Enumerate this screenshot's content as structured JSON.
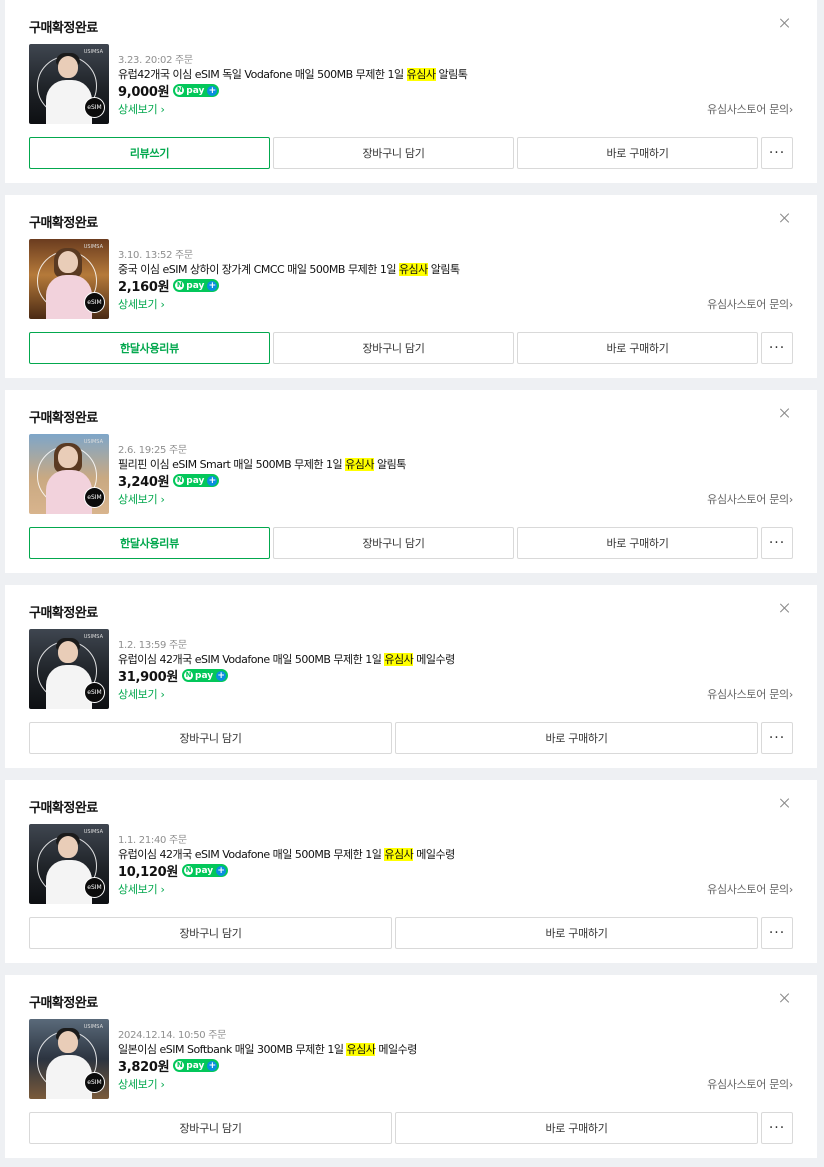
{
  "orders": [
    {
      "status": "구매확정완료",
      "date": "3.23. 20:02 주문",
      "name_before": "유럽42개국 이심 eSIM 독일 Vodafone 매일 500MB 무제한 1일 ",
      "name_highlight": "유심사",
      "name_after": " 알림톡",
      "price": "9,000원",
      "detail": "상세보기",
      "inquiry": "유심사스토어 문의",
      "review_label": "리뷰쓰기",
      "cart_label": "장바구니 담기",
      "buy_label": "바로 구매하기",
      "more_label": "···",
      "thumb_theme": "europe"
    },
    {
      "status": "구매확정완료",
      "date": "3.10. 13:52 주문",
      "name_before": "중국 이심 eSIM 상하이 장가계 CMCC 매일 500MB 무제한 1일 ",
      "name_highlight": "유심사",
      "name_after": " 알림톡",
      "price": "2,160원",
      "detail": "상세보기",
      "inquiry": "유심사스토어 문의",
      "review_label": "한달사용리뷰",
      "cart_label": "장바구니 담기",
      "buy_label": "바로 구매하기",
      "more_label": "···",
      "thumb_theme": "china"
    },
    {
      "status": "구매확정완료",
      "date": "2.6. 19:25 주문",
      "name_before": "필리핀 이심 eSIM Smart 매일 500MB 무제한 1일 ",
      "name_highlight": "유심사",
      "name_after": " 알림톡",
      "price": "3,240원",
      "detail": "상세보기",
      "inquiry": "유심사스토어 문의",
      "review_label": "한달사용리뷰",
      "cart_label": "장바구니 담기",
      "buy_label": "바로 구매하기",
      "more_label": "···",
      "thumb_theme": "philippines"
    },
    {
      "status": "구매확정완료",
      "date": "1.2. 13:59 주문",
      "name_before": "유럽이심 42개국 eSIM Vodafone 매일 500MB 무제한 1일 ",
      "name_highlight": "유심사",
      "name_after": " 메일수령",
      "price": "31,900원",
      "detail": "상세보기",
      "inquiry": "유심사스토어 문의",
      "cart_label": "장바구니 담기",
      "buy_label": "바로 구매하기",
      "more_label": "···",
      "thumb_theme": "europe"
    },
    {
      "status": "구매확정완료",
      "date": "1.1. 21:40 주문",
      "name_before": "유럽이심 42개국 eSIM Vodafone 매일 500MB 무제한 1일 ",
      "name_highlight": "유심사",
      "name_after": " 메일수령",
      "price": "10,120원",
      "detail": "상세보기",
      "inquiry": "유심사스토어 문의",
      "cart_label": "장바구니 담기",
      "buy_label": "바로 구매하기",
      "more_label": "···",
      "thumb_theme": "europe"
    },
    {
      "status": "구매확정완료",
      "date": "2024.12.14. 10:50 주문",
      "name_before": "일본이심 eSIM Softbank 매일 300MB 무제한 1일 ",
      "name_highlight": "유심사",
      "name_after": " 메일수령",
      "price": "3,820원",
      "detail": "상세보기",
      "inquiry": "유심사스토어 문의",
      "cart_label": "장바구니 담기",
      "buy_label": "바로 구매하기",
      "more_label": "···",
      "thumb_theme": "japan"
    }
  ],
  "npay": {
    "n": "N",
    "text": "pay",
    "plus": "+"
  },
  "thumb": {
    "badge": "eSIM",
    "brand": "USIMSA"
  },
  "colors": {
    "accent_green": "#03c75a",
    "link_green": "#03a84e",
    "highlight": "#ffff00",
    "background": "#eef0f3"
  }
}
